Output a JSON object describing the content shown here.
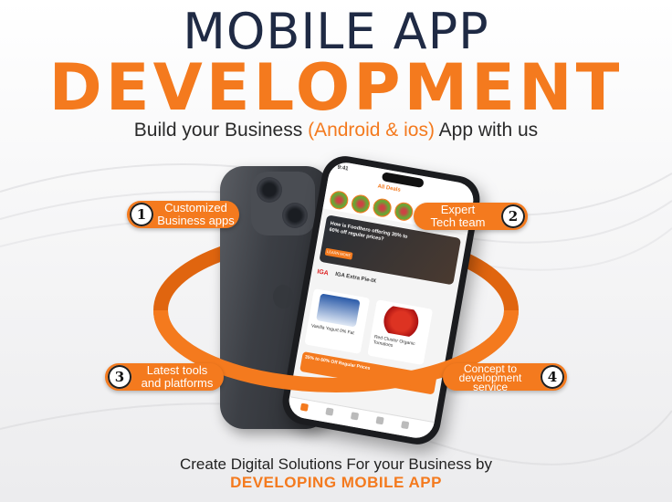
{
  "header": {
    "line1": "MOBILE APP",
    "line2": "DEVELOPMENT",
    "tagline_start": "Build your Business ",
    "tagline_highlight": "(Android & ios)",
    "tagline_end": " App with us"
  },
  "features": [
    {
      "number": "1",
      "label_line1": "Customized",
      "label_line2": "Business apps"
    },
    {
      "number": "2",
      "label_line1": "Expert",
      "label_line2": "Tech team"
    },
    {
      "number": "3",
      "label_line1": "Latest tools",
      "label_line2": "and platforms"
    },
    {
      "number": "4",
      "label_line1": "Concept to",
      "label_line2": "development",
      "label_line3": "service"
    }
  ],
  "phone_screen": {
    "time": "9:41",
    "deals_label": "All Deals",
    "banner_title": "How is Foodhero offering 35% to 60% off regular prices?",
    "banner_button": "LEARN MORE",
    "store_logo": "IGA",
    "store_name": "IGA Extra Pie-IX",
    "products": [
      {
        "name": "Vanilla Yogurt 0% Fat"
      },
      {
        "name": "Red Cluster Organic Tomatoes"
      }
    ],
    "offer": "35% to 60% Off Regular Prices"
  },
  "footer": {
    "line1": "Create Digital Solutions For your Business by",
    "line2": "DEVELOPING MOBILE APP"
  },
  "colors": {
    "accent": "#f47a1e",
    "navy": "#1f2a44"
  }
}
